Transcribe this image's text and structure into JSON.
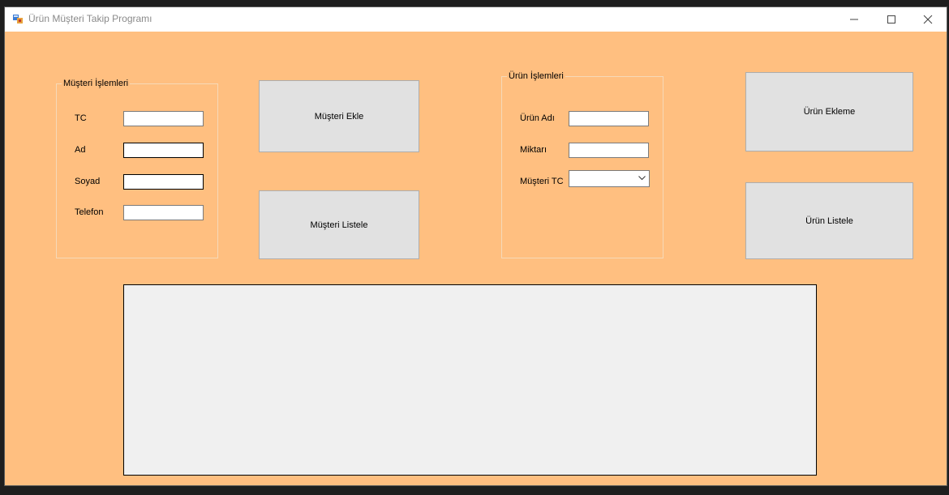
{
  "window": {
    "title": "Ürün Müşteri Takip Programı",
    "icon": "app-form-icon",
    "controls": [
      "minimize-icon",
      "maximize-icon",
      "close-icon"
    ]
  },
  "colors": {
    "form_background": "#ffbf80",
    "button_background": "#e1e1e1",
    "grid_background": "#f0f0f0"
  },
  "customer_group": {
    "title": "Müşteri İşlemleri",
    "fields": {
      "tc_label": "TC",
      "tc_value": "",
      "ad_label": "Ad",
      "ad_value": "",
      "soyad_label": "Soyad",
      "soyad_value": "",
      "telefon_label": "Telefon",
      "telefon_value": ""
    }
  },
  "customer_buttons": {
    "add_label": "Müşteri Ekle",
    "list_label": "Müşteri Listele"
  },
  "product_group": {
    "title": "Ürün İşlemleri",
    "fields": {
      "urun_adi_label": "Ürün Adı",
      "urun_adi_value": "",
      "miktar_label": "Miktarı",
      "miktar_value": "",
      "musteri_tc_label": "Müşteri TC",
      "musteri_tc_selected": ""
    }
  },
  "product_buttons": {
    "add_label": "Ürün Ekleme",
    "list_label": "Ürün Listele"
  },
  "data_grid": {
    "rows": []
  }
}
